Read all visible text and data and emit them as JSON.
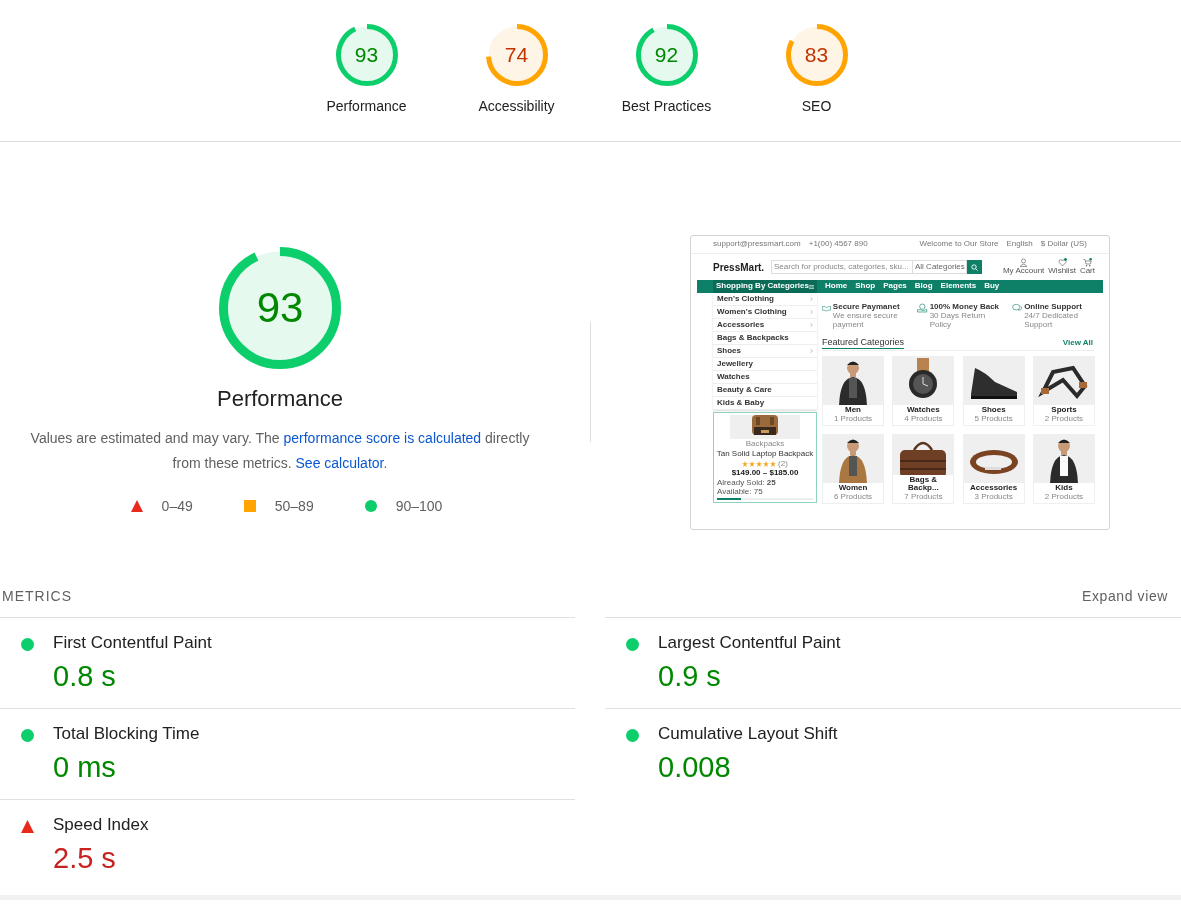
{
  "categories": [
    {
      "label": "Performance",
      "score": "93",
      "level": 0.93,
      "color": "#0cce6b"
    },
    {
      "label": "Accessibility",
      "score": "74",
      "level": 0.74,
      "color": "#ffa400"
    },
    {
      "label": "Best Practices",
      "score": "92",
      "level": 0.92,
      "color": "#0cce6b"
    },
    {
      "label": "SEO",
      "score": "83",
      "level": 0.83,
      "color": "#ffa400"
    }
  ],
  "performance": {
    "score": "93",
    "level": 0.93,
    "color": "#0cce6b",
    "title": "Performance",
    "description": [
      {
        "kind": "text",
        "text": "Values are estimated and may vary. The "
      },
      {
        "kind": "link",
        "text": "performance score is calculated"
      },
      {
        "kind": "text",
        "text": " directly from these metrics. "
      },
      {
        "kind": "link",
        "text": "See calculator"
      },
      {
        "kind": "text",
        "text": "."
      }
    ],
    "legend": [
      {
        "kind": "fail",
        "label": "0–49"
      },
      {
        "kind": "average",
        "label": "50–89"
      },
      {
        "kind": "pass",
        "label": "90–100"
      }
    ]
  },
  "screenshot": {
    "contact": [
      "support@pressmart.com",
      "+1(00) 4567 890"
    ],
    "top_links": [
      "Welcome to Our Store",
      "English",
      "$ Dollar (US)"
    ],
    "logo": "PressMart.",
    "search_placeholder": "Search for products, categories, sku...",
    "category_select": "All Categories",
    "header_links": [
      {
        "kind": "account",
        "label": "My Account"
      },
      {
        "kind": "wishlist",
        "label": "Wishlist"
      },
      {
        "kind": "cart",
        "label": "Cart"
      }
    ],
    "nav_title": "Shopping By Categories",
    "nav_links": [
      "Home",
      "Shop",
      "Pages",
      "Blog",
      "Elements",
      "Buy"
    ],
    "side_categories": [
      {
        "label": "Men's Clothing",
        "submenu": true
      },
      {
        "label": "Women's Clothing",
        "submenu": true
      },
      {
        "label": "Accessories",
        "submenu": true
      },
      {
        "label": "Bags & Backpacks",
        "submenu": false
      },
      {
        "label": "Shoes",
        "submenu": true
      },
      {
        "label": "Jewellery",
        "submenu": false
      },
      {
        "label": "Watches",
        "submenu": false
      },
      {
        "label": "Beauty & Care",
        "submenu": false
      },
      {
        "label": "Kids & Baby",
        "submenu": false
      }
    ],
    "product": {
      "category": "Backpacks",
      "name": "Tan Solid Laptop Backpack",
      "stars": 5,
      "reviews": "(2)",
      "price": "$149.00 – $185.00",
      "sold": "Already Sold: **25**",
      "available": "Available: 75",
      "level": 0.25
    },
    "features": [
      {
        "kind": "payment",
        "title": "Secure Paymanet",
        "text": "We ensure secure payment"
      },
      {
        "kind": "money",
        "title": "100% Money Back",
        "text": "30 Days Return Policy"
      },
      {
        "kind": "support",
        "title": "Online Support",
        "text": "24/7 Dedicated Support"
      }
    ],
    "featured_title": "Featured Categories",
    "view_all": "View All",
    "tiles": [
      {
        "name": "Men",
        "count": "1 Products"
      },
      {
        "name": "Watches",
        "count": "4 Products"
      },
      {
        "name": "Shoes",
        "count": "5 Products"
      },
      {
        "name": "Sports",
        "count": "2 Products"
      },
      {
        "name": "Women",
        "count": "6 Products"
      },
      {
        "name": "Bags & Backp...",
        "count": "7 Products"
      },
      {
        "name": "Accessories",
        "count": "3 Products"
      },
      {
        "name": "Kids",
        "count": "2 Products"
      }
    ]
  },
  "metrics": {
    "heading": "METRICS",
    "toggle": "Expand view",
    "items": [
      {
        "label": "First Contentful Paint",
        "value": "0.8 s",
        "kind": "pass"
      },
      {
        "label": "Largest Contentful Paint",
        "value": "0.9 s",
        "kind": "pass"
      },
      {
        "label": "Total Blocking Time",
        "value": "0 ms",
        "kind": "pass"
      },
      {
        "label": "Cumulative Layout Shift",
        "value": "0.008",
        "kind": "pass"
      },
      {
        "label": "Speed Index",
        "value": "2.5 s",
        "kind": "fail"
      }
    ]
  }
}
